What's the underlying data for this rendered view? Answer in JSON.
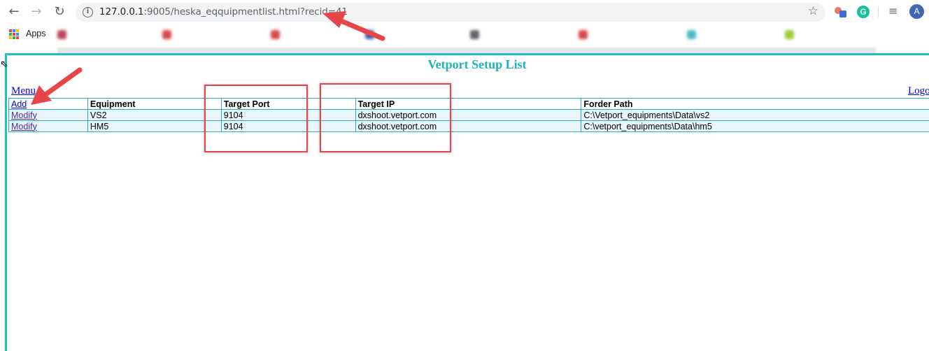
{
  "browser": {
    "url_host": "127.0.0.1",
    "url_path": ":9005/heska_eqquipmentlist.html?recid=41",
    "avatar_letter": "A",
    "ext_letter": "G",
    "apps_label": "Apps"
  },
  "page": {
    "title": "Vetport Setup List",
    "menu_link": "Menu",
    "logout_link": "Logo"
  },
  "table": {
    "add_link": "Add",
    "headers": [
      "Equipment",
      "Target Port",
      "Target IP",
      "Forder Path"
    ],
    "rows": [
      {
        "action": "Modify",
        "equipment": "VS2",
        "port": "9104",
        "ip": "dxshoot.vetport.com",
        "path": "C:\\Vetport_equipments\\Data\\vs2"
      },
      {
        "action": "Modify",
        "equipment": "HM5",
        "port": "9104",
        "ip": "dxshoot.vetport.com",
        "path": "C:\\vetport_equipments\\Data\\hm5"
      }
    ]
  },
  "colors": {
    "accent": "#20b2b8",
    "annotation": "#e8454a",
    "row_bg": "#eaf4fb"
  }
}
